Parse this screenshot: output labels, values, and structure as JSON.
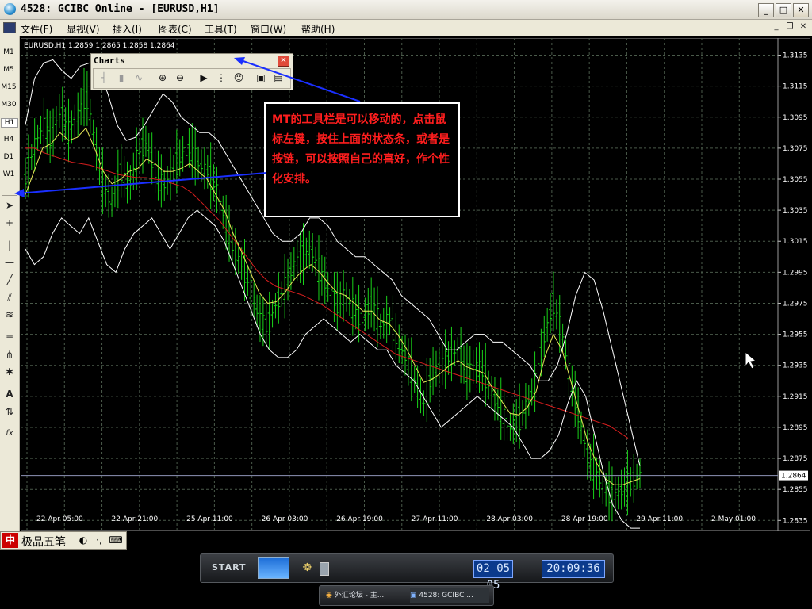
{
  "window": {
    "title": "4528: GCIBC Online - [EURUSD,H1]",
    "min": "_",
    "max": "□",
    "close": "✕"
  },
  "menu": [
    "文件(F)",
    "显视(V)",
    "插入(I)",
    "图表(C)",
    "工具(T)",
    "窗口(W)",
    "帮助(H)"
  ],
  "timeframes": [
    "M1",
    "M5",
    "M15",
    "M30",
    "H1",
    "H4",
    "D1",
    "W1"
  ],
  "selected_timeframe": "H1",
  "chart_info": "EURUSD,H1  1.2859 1.2865 1.2858 1.2864",
  "charts_panel": {
    "title": "Charts",
    "close": "✕"
  },
  "annotation": {
    "highlight": "MT",
    "text": "的工具栏是可以移动的，点击鼠标左键，按住上面的状态条，或者是按链，可以按照自己的喜好，作个性化安排。"
  },
  "ime_bar": {
    "name": "极品五笔"
  },
  "price_label": "1.2864",
  "taskbar": {
    "start": "START",
    "date": "02 05 05",
    "time": "20:09:36"
  },
  "tasks": [
    "外汇论坛 - 主...",
    "4528: GCIBC ..."
  ],
  "colors": {
    "candles": "#19d219",
    "ma_slow": "#d81e1e",
    "ma_fast": "#e8e858",
    "bands": "#ffffff",
    "grid": "#4a5a4a",
    "annotation_text": "#ff1e1e"
  },
  "chart_data": {
    "type": "line",
    "title": "",
    "symbol": "EURUSD,H1",
    "yticks": [
      "1.3135",
      "1.3115",
      "1.3095",
      "1.3075",
      "1.3055",
      "1.3035",
      "1.3015",
      "1.2995",
      "1.2975",
      "1.2955",
      "1.2935",
      "1.2915",
      "1.2895",
      "1.2875",
      "1.2855",
      "1.2835"
    ],
    "xticks": [
      "22 Apr 05:00",
      "22 Apr 21:00",
      "25 Apr 11:00",
      "26 Apr 03:00",
      "26 Apr 19:00",
      "27 Apr 11:00",
      "28 Apr 03:00",
      "28 Apr 19:00",
      "29 Apr 11:00",
      "2 May 01:00"
    ],
    "ylim": [
      1.2828,
      1.3146
    ],
    "last_price": 1.2864,
    "grid": true,
    "series": [
      {
        "values": [
          1.3055,
          1.3075,
          1.309,
          1.308,
          1.31,
          1.3085,
          1.3095,
          1.311,
          1.308,
          1.305,
          1.304,
          1.306,
          1.305,
          1.307,
          1.308,
          1.306,
          1.305,
          1.306,
          1.307,
          1.3075,
          1.3065,
          1.306,
          1.305,
          1.303,
          1.301,
          1.3,
          1.2985,
          1.2965,
          1.296,
          1.2975,
          1.2985,
          1.3,
          1.3005,
          1.301,
          1.2995,
          1.2985,
          1.2975,
          1.298,
          1.297,
          1.2965,
          1.2975,
          1.296,
          1.2965,
          1.295,
          1.294,
          1.2925,
          1.291,
          1.293,
          1.2935,
          1.294,
          1.2945,
          1.293,
          1.2935,
          1.293,
          1.2915,
          1.2905,
          1.2895,
          1.29,
          1.291,
          1.2925,
          1.2955,
          1.2975,
          1.2955,
          1.2925,
          1.29,
          1.2875,
          1.2865,
          1.2855,
          1.285,
          1.2855,
          1.286,
          1.2865
        ]
      },
      {
        "values": [
          1.3075,
          1.3075,
          1.3072,
          1.307,
          1.3068,
          1.3066,
          1.3065,
          1.3064,
          1.3062,
          1.306,
          1.3058,
          1.3057,
          1.3056,
          1.3056,
          1.3055,
          1.3054,
          1.3052,
          1.305,
          1.3046,
          1.304,
          1.3034,
          1.3028,
          1.302,
          1.3012,
          1.3004,
          1.2996,
          1.299,
          1.2986,
          1.2984,
          1.2982,
          1.298,
          1.2977,
          1.2974,
          1.297,
          1.2966,
          1.2962,
          1.2958,
          1.2954,
          1.295,
          1.2946,
          1.2942,
          1.294,
          1.2938,
          1.2936,
          1.2934,
          1.2932,
          1.293,
          1.2928,
          1.2926,
          1.2924,
          1.2922,
          1.292,
          1.2918,
          1.2916,
          1.2914,
          1.2912,
          1.291,
          1.2908,
          1.2906,
          1.2904,
          1.2902,
          1.29,
          1.2898,
          1.2896,
          1.2892,
          1.2888
        ]
      },
      {
        "values": [
          1.3045,
          1.306,
          1.3075,
          1.3078,
          1.3085,
          1.308,
          1.3082,
          1.3088,
          1.3075,
          1.306,
          1.3052,
          1.3055,
          1.306,
          1.3062,
          1.3068,
          1.3065,
          1.306,
          1.306,
          1.3062,
          1.3065,
          1.306,
          1.3055,
          1.3045,
          1.3035,
          1.302,
          1.3008,
          1.2995,
          1.2982,
          1.2975,
          1.2976,
          1.2982,
          1.299,
          1.2996,
          1.3,
          1.2995,
          1.2988,
          1.2982,
          1.298,
          1.2975,
          1.297,
          1.297,
          1.2964,
          1.2962,
          1.2955,
          1.2946,
          1.2935,
          1.2924,
          1.2926,
          1.293,
          1.2935,
          1.2938,
          1.2934,
          1.2932,
          1.293,
          1.292,
          1.2912,
          1.2904,
          1.2903,
          1.2908,
          1.2918,
          1.294,
          1.2955,
          1.2945,
          1.2925,
          1.2905,
          1.2885,
          1.2872,
          1.2862,
          1.2858,
          1.2858,
          1.286,
          1.2862
        ]
      },
      {
        "values": [
          1.309,
          1.312,
          1.313,
          1.3132,
          1.3125,
          1.312,
          1.3128,
          1.313,
          1.3125,
          1.311,
          1.309,
          1.308,
          1.3082,
          1.309,
          1.31,
          1.311,
          1.3105,
          1.3095,
          1.309,
          1.3085,
          1.3085,
          1.308,
          1.307,
          1.306,
          1.305,
          1.304,
          1.303,
          1.302,
          1.3015,
          1.3015,
          1.302,
          1.303,
          1.303,
          1.3025,
          1.3015,
          1.301,
          1.3005,
          1.3005,
          1.3,
          1.2995,
          1.299,
          1.298,
          1.2975,
          1.297,
          1.2965,
          1.2955,
          1.2945,
          1.2945,
          1.295,
          1.2955,
          1.2955,
          1.295,
          1.295,
          1.2945,
          1.294,
          1.2935,
          1.2925,
          1.2925,
          1.2935,
          1.2955,
          1.298,
          1.2995,
          1.299,
          1.297,
          1.2945,
          1.292,
          1.2895,
          1.287
        ]
      },
      {
        "values": [
          1.301,
          1.3,
          1.3005,
          1.302,
          1.303,
          1.3025,
          1.302,
          1.303,
          1.3015,
          1.3,
          1.2995,
          1.301,
          1.302,
          1.3025,
          1.303,
          1.302,
          1.301,
          1.302,
          1.303,
          1.3035,
          1.303,
          1.3025,
          1.3015,
          1.3,
          1.2985,
          1.297,
          1.2955,
          1.2945,
          1.294,
          1.294,
          1.2945,
          1.2955,
          1.296,
          1.2965,
          1.296,
          1.2955,
          1.295,
          1.2955,
          1.295,
          1.2945,
          1.2945,
          1.2935,
          1.293,
          1.2925,
          1.2915,
          1.2905,
          1.2895,
          1.29,
          1.2905,
          1.291,
          1.2915,
          1.291,
          1.2905,
          1.29,
          1.2895,
          1.2885,
          1.2875,
          1.2875,
          1.288,
          1.289,
          1.291,
          1.2925,
          1.2915,
          1.289,
          1.2865,
          1.2845,
          1.2835,
          1.283,
          1.283
        ]
      }
    ]
  }
}
